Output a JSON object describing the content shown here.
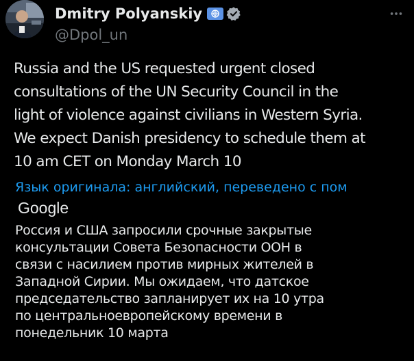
{
  "author": {
    "display_name": "Dmitry Polyanskiy",
    "handle": "@Dpol_un",
    "badge_color": "#5b92e5",
    "verified_color": "#a4abb3"
  },
  "icons": {
    "avatar": "profile-photo",
    "affiliation": "un-emblem-icon",
    "verified": "verified-check-icon",
    "more": "more-horizontal-icon"
  },
  "tweet": {
    "text": "Russia and the US requested urgent closed\nconsultations of the UN Security Council in the\nlight of violence against civilians in Western Syria.\nWe expect Danish presidency to schedule them at\n10 am CET on Monday March 10",
    "translation_notice": "Язык оригинала: английский, переведено с пом",
    "translation_provider": "Google",
    "translated_text": "Россия и США запросили срочные закрытые\nконсультации Совета Безопасности ООН в\nсвязи с насилием против мирных жителей в\nЗападной Сирии. Мы ожидаем, что датское\nпредседательство запланирует их на 10 утра\nпо центральноевропейскому времени в\nпонедельник 10 марта"
  },
  "colors": {
    "background": "#000000",
    "text": "#e7e9ea",
    "secondary": "#71767b",
    "link": "#1d9bf0"
  }
}
